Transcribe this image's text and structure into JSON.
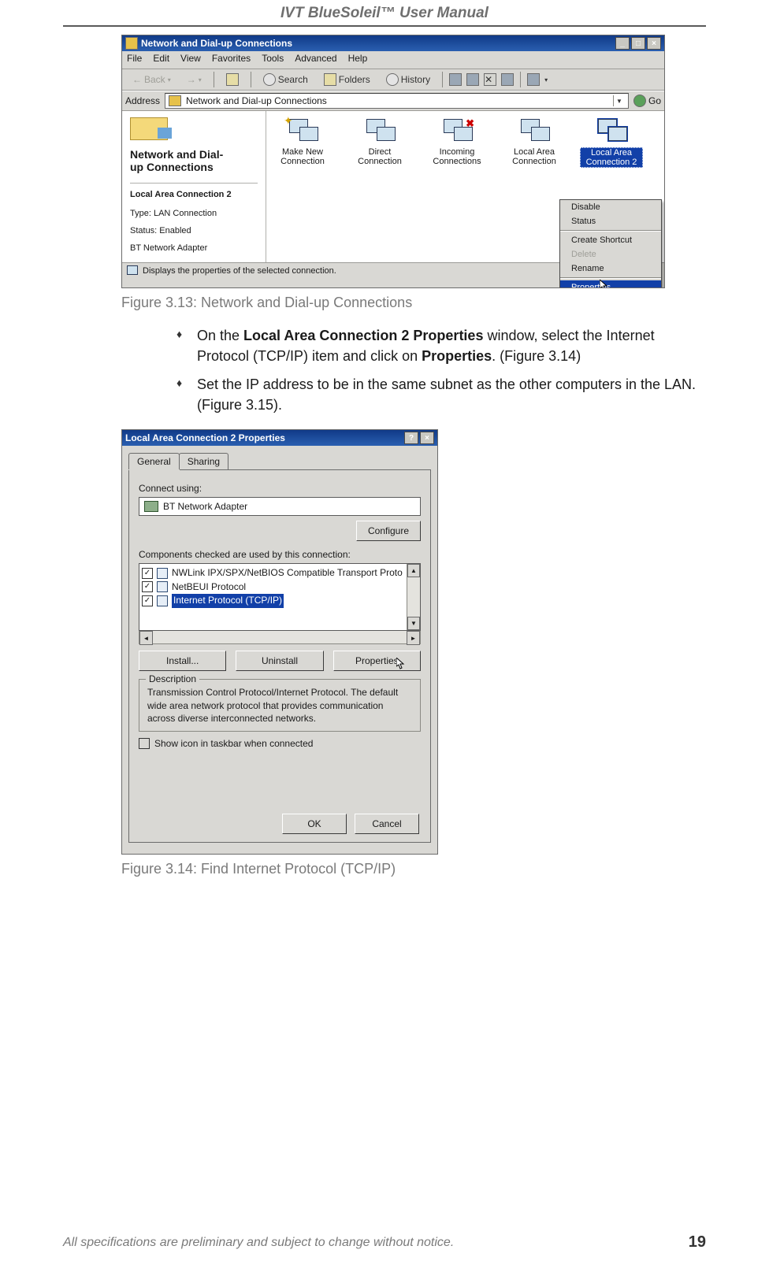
{
  "header": "IVT BlueSoleil™ User Manual",
  "figure1": {
    "window_title": "Network and Dial-up Connections",
    "menubar": [
      "File",
      "Edit",
      "View",
      "Favorites",
      "Tools",
      "Advanced",
      "Help"
    ],
    "toolbar": {
      "back": "Back",
      "search": "Search",
      "folders": "Folders",
      "history": "History"
    },
    "address_label": "Address",
    "address_value": "Network and Dial-up Connections",
    "go_label": "Go",
    "sidebar": {
      "title": "Network and Dial-up Connections",
      "subheading": "Local Area Connection 2",
      "type_line": "Type: LAN Connection",
      "status_line": "Status: Enabled",
      "adapter_line": "BT Network Adapter"
    },
    "items": [
      {
        "label": "Make New Connection",
        "kind": "wizard"
      },
      {
        "label": "Direct Connection",
        "kind": "conn"
      },
      {
        "label": "Incoming Connections",
        "kind": "in"
      },
      {
        "label": "Local Area Connection",
        "kind": "lan"
      },
      {
        "label": "Local Area Connection 2",
        "kind": "lan",
        "selected": true
      }
    ],
    "context_menu": [
      {
        "label": "Disable"
      },
      {
        "label": "Status"
      },
      {
        "sep": true
      },
      {
        "label": "Create Shortcut"
      },
      {
        "label": "Delete",
        "disabled": true
      },
      {
        "label": "Rename"
      },
      {
        "sep": true
      },
      {
        "label": "Properties",
        "selected": true
      }
    ],
    "statusbar_text": "Displays the properties of the selected connection."
  },
  "caption1": "Figure 3.13: Network and Dial-up Connections",
  "bullets": {
    "b1_pre": "On the ",
    "b1_bold1": "Local Area Connection 2 Properties",
    "b1_mid": " window, select the Internet Protocol (TCP/IP) item and click on ",
    "b1_bold2": "Properties",
    "b1_post": ". (Figure 3.14)",
    "b2": "Set the IP address to be in the same subnet as the other computers in the LAN. (Figure 3.15)."
  },
  "figure2": {
    "title": "Local Area Connection 2 Properties",
    "tabs": [
      "General",
      "Sharing"
    ],
    "connect_using_label": "Connect using:",
    "adapter": "BT Network Adapter",
    "configure_btn": "Configure",
    "components_label": "Components checked are used by this connection:",
    "components": [
      {
        "text": "NWLink IPX/SPX/NetBIOS Compatible Transport Proto"
      },
      {
        "text": "NetBEUI Protocol"
      },
      {
        "text": "Internet Protocol (TCP/IP)",
        "selected": true
      }
    ],
    "install_btn": "Install...",
    "uninstall_btn": "Uninstall",
    "properties_btn": "Properties",
    "desc_legend": "Description",
    "description": "Transmission Control Protocol/Internet Protocol. The default wide area network protocol that provides communication across diverse interconnected networks.",
    "show_icon": "Show icon in taskbar when connected",
    "ok_btn": "OK",
    "cancel_btn": "Cancel"
  },
  "caption2": "Figure 3.14: Find Internet Protocol (TCP/IP)",
  "footer_text": "All specifications are preliminary and subject to change without notice.",
  "page_number": "19"
}
